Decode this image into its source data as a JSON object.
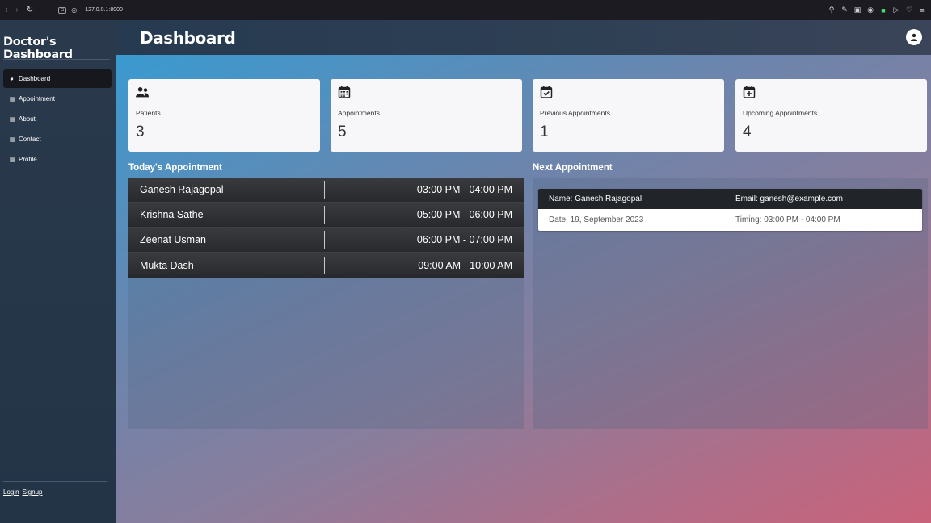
{
  "browser": {
    "url": "127.0.0.1:8000",
    "back_icon": "chevron-left-icon",
    "forward_icon": "chevron-right-icon",
    "reload_icon": "reload-icon"
  },
  "sidebar": {
    "brand": "Doctor's Dashboard",
    "items": [
      {
        "label": "Dashboard",
        "icon": "dashboard-icon",
        "active": true
      },
      {
        "label": "Appointment",
        "icon": "list-icon"
      },
      {
        "label": "About",
        "icon": "list-icon"
      },
      {
        "label": "Contact",
        "icon": "list-icon"
      },
      {
        "label": "Profile",
        "icon": "list-icon"
      }
    ],
    "footer": {
      "login": "Login",
      "signup": "Signup"
    }
  },
  "header": {
    "title": "Dashboard",
    "user_icon": "user-icon"
  },
  "stats": [
    {
      "label": "Patients",
      "value": "3",
      "icon": "users-icon"
    },
    {
      "label": "Appointments",
      "value": "5",
      "icon": "calendar-icon"
    },
    {
      "label": "Previous Appointments",
      "value": "1",
      "icon": "calendar-check-icon"
    },
    {
      "label": "Upcoming Appointments",
      "value": "4",
      "icon": "calendar-plus-icon"
    }
  ],
  "today": {
    "title": "Today's Appointment",
    "rows": [
      {
        "name": "Ganesh Rajagopal",
        "time": "03:00 PM - 04:00 PM"
      },
      {
        "name": "Krishna Sathe",
        "time": "05:00 PM - 06:00 PM"
      },
      {
        "name": "Zeenat Usman",
        "time": "06:00 PM - 07:00 PM"
      },
      {
        "name": "Mukta Dash",
        "time": "09:00 AM - 10:00 AM"
      }
    ]
  },
  "next": {
    "title": "Next Appointment",
    "name": "Name: Ganesh Rajagopal",
    "email": "Email: ganesh@example.com",
    "date": "Date: 19, September 2023",
    "timing": "Timing: 03:00 PM - 04:00 PM"
  }
}
